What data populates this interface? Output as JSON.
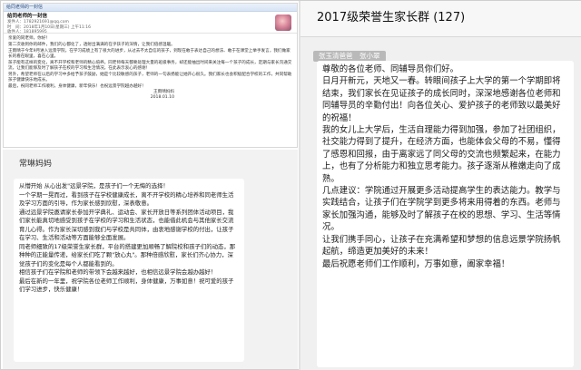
{
  "email": {
    "window_title": "给同老师的一封信",
    "subject": "给同老师的一封信",
    "from_line": "发件人：1782921691@qq.com",
    "time_line": "时　间：2018年1月10日(星期三) 上午11:16",
    "to_line": "收件人：181895995",
    "greeting": "亲爱的同老师，你好！",
    "paragraphs": [
      "第二次收到你的邮件，我们的心都化了，透射出满满的在乎孩子的深情，让我们倍感温暖。",
      "王雨晴于今年9月进入远景学院，在学习成绩上有了很大的进步，从过去不太自信的孩子，到现在敢于表达自己的想法、敢于在课堂上举手发言，我们做家长的看在眼里，喜在心里。",
      "孩子能有这样的变化，离不开学校和老师的精心培养。同老师每天都要处理大量的班级事务，却还能抽出时间来关注每一个孩子的成长，定期与家长沟通交流，让我们能够及时了解孩子在校的学习和生活情况，在此表示衷心的感谢！",
      "另外，希望老师在以后的学习中多给予孩子鼓励，她是个比较敏感的孩子，老师的一句表扬能让她开心很久。我们家长也会积极配合学校的工作，共同帮助孩子健康快乐地成长。",
      "最后，祝同老师工作顺利，身体健康，新年快乐！也祝远景学院越办越好！"
    ],
    "signature": "王雨晴妈妈",
    "date": "2018.01.10"
  },
  "chat_left": {
    "contact_name": "常琳妈妈",
    "paragraphs": [
      "从懵开始 从心出发\"远景学院，是孩子们一个无悔的选择！",
      "一个学期一晃而过，看到孩子在学校健康成长，离不开学校的精心培养和同老师生活及学习方面的引导，作为家长感到欣慰，深表敬意。",
      "通过远景学院邀请家长参加开学典礼、运动会、家长开放日等系列团体活动项目，我们家长能真切地感受到孩子在学校的学习和生活状态，也能借此机会与其他家长交流育儿心得。作为家长深切感到我们与学校是共同体，由衷地感谢学校的付出，让孩子在学习、生活和活动等方面能够全面发展。",
      "同老师细致的17级荣誉生家长群，平台的搭建更加顺畅了解院校和孩子们的动态，那种种的正能量传递，给家长们吃了颗\"放心丸\"。那种倍感欣慰，家长们齐心协力，深觉孩子们的变化是每个人都能看到的。",
      "相信孩子们在学院和老师的带领下会越来越好，也相信远景学院会越办越好！",
      "最后在新的一年里，祝学院各位老师工作顺利，身体健康，万事如意！祝可爱的孩子们学习进步，快乐健康！"
    ]
  },
  "chat_right": {
    "group_title": "2017级荣誉生家长群 (127)",
    "sender_label": "张玉清爸爸　张小翠",
    "paragraphs": [
      "尊敬的各位老师、同辅导员你们好。",
      "日月开新元，天地又一春。转眼间孩子上大学的第一个学期即将结束，我们家长在见证孩子的成长同时，深深地感谢各位老师和同辅导员的辛勤付出！向各位关心、爱护孩子的老师致以最美好的祝福！",
      "我的女儿上大学后，生活自理能力得到加强，参加了社团组织，社交能力得到了提升，在经济方面，也能体会父母的不易，懂得了感恩和回报，由于离家远了同父母的交流也频繁起来，在能力上，也有了分析能力和独立思考能力。孩子逐渐从稚嫩走向了成熟。",
      "几点建议：学院通过开展更多活动提高学生的表达能力。教学与实践结合，让孩子们在学院学到更多将来用得着的东西。老师与家长加强沟通，能够及时了解孩子在校的思想、学习、生活等情况。",
      "让我们携手同心，让孩子在充满希望和梦想的信息远景学院扬帆起航，缔造更加美好的未来！",
      "最后祝愿老师们工作顺利，万事如意，阖家幸福！"
    ]
  }
}
